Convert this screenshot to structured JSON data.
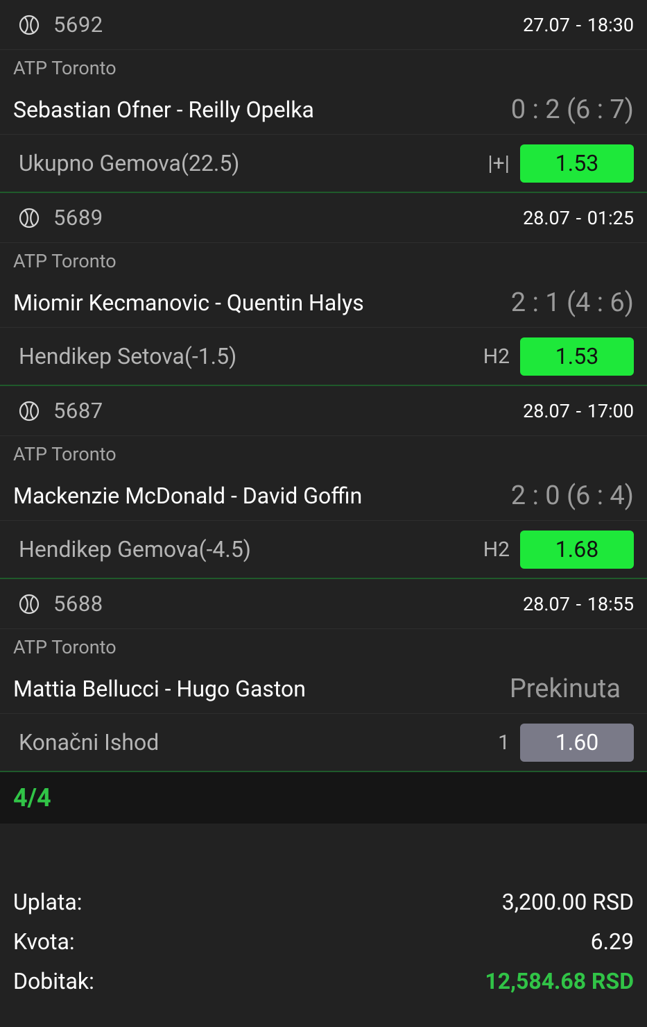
{
  "matches": [
    {
      "id": "5692",
      "datetime": "27.07  -  18:30",
      "league": "ATP Toronto",
      "teams": "Sebastian Ofner - Reilly Opelka",
      "score": "0 : 2 (6 : 7)",
      "market": "Ukupno Gemova(22.5)",
      "pick": "|+|",
      "odd": "1.53",
      "odd_status": "won"
    },
    {
      "id": "5689",
      "datetime": "28.07  -  01:25",
      "league": "ATP Toronto",
      "teams": "Miomir Kecmanovic - Quentin Halys",
      "score": "2 : 1 (4 : 6)",
      "market": "Hendikep Setova(-1.5)",
      "pick": "H2",
      "odd": "1.53",
      "odd_status": "won"
    },
    {
      "id": "5687",
      "datetime": "28.07  -  17:00",
      "league": "ATP Toronto",
      "teams": "Mackenzie McDonald - David Goffin",
      "score": "2 : 0 (6 : 4)",
      "market": "Hendikep Gemova(-4.5)",
      "pick": "H2",
      "odd": "1.68",
      "odd_status": "won"
    },
    {
      "id": "5688",
      "datetime": "28.07  -  18:55",
      "league": "ATP Toronto",
      "teams": "Mattia Bellucci - Hugo Gaston",
      "score": "Prekinuta",
      "market": "Konačni Ishod",
      "pick": "1",
      "odd": "1.60",
      "odd_status": "void"
    }
  ],
  "count": "4/4",
  "summary": {
    "stake_label": "Uplata:",
    "stake_value": "3,200.00 RSD",
    "odds_label": "Kvota:",
    "odds_value": "6.29",
    "win_label": "Dobitak:",
    "win_value": "12,584.68 RSD"
  },
  "colors": {
    "background": "#222222",
    "won_green": "#1ee83a",
    "void_gray": "#7a7a88",
    "accent_green": "#31c447"
  },
  "icons": {
    "sport": "tennis-ball-icon"
  }
}
